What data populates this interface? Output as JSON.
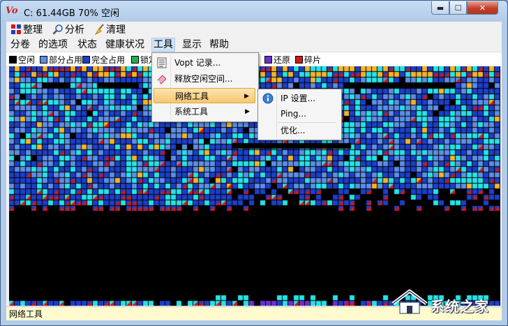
{
  "window": {
    "title": "C:  61.44GB 70% 空闲",
    "minimize": "▬",
    "maximize": "☐",
    "close": "✕"
  },
  "toolbar": {
    "defrag_label": "整理",
    "analyze_label": "分析",
    "clean_label": "清理"
  },
  "menubar": {
    "volume": "分卷",
    "options": "的选项",
    "status": "状态",
    "health": "健康状况",
    "tools": "工具",
    "view": "显示",
    "help": "帮助"
  },
  "legend": [
    {
      "label": "空闲",
      "color": "#000000"
    },
    {
      "label": "部分占用",
      "color": "#5d8ee6"
    },
    {
      "label": "完全占用",
      "color": "#1d3fc8"
    },
    {
      "label": "锁定",
      "color": "#22b14c"
    },
    {
      "label": "还原",
      "color": "#6e2fd0"
    },
    {
      "label": "碎片",
      "color": "#d01919"
    }
  ],
  "tools_menu": {
    "items": [
      {
        "label": "Vopt 记录...",
        "icon": "document-list-icon"
      },
      {
        "label": "释放空闲空间...",
        "icon": "eraser-icon"
      },
      {
        "label": "网络工具",
        "icon": "",
        "submenu": true
      },
      {
        "label": "系统工具",
        "icon": "",
        "submenu": true
      }
    ]
  },
  "network_menu": {
    "items": [
      {
        "label": "IP 设置...",
        "icon": "info-icon"
      },
      {
        "label": "Ping..."
      },
      {
        "label": "优化..."
      }
    ]
  },
  "statusbar": {
    "text": "网络工具"
  },
  "watermark": {
    "text": "系统之家"
  },
  "colors": {
    "free": "#000000",
    "partial": "#5d8ee6",
    "full": "#1d3fc8",
    "cyan": "#25e3e8",
    "fragment": "#d01919",
    "gold": "#f2b42c",
    "restore": "#6e2fd0",
    "locked": "#22b14c",
    "menu_highlight": "#f7c86e"
  }
}
